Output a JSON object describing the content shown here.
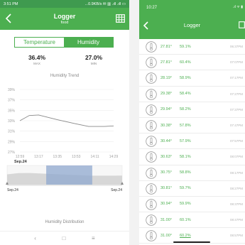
{
  "left_phone": {
    "status_bar": {
      "time": "3:51 PM",
      "icons": "...0.9KB/s ✉ ▥ .ıll .ıll ▭"
    },
    "header": {
      "title": "Logger",
      "subtitle": "food"
    },
    "tabs": [
      {
        "label": "Temperature",
        "active": false
      },
      {
        "label": "Humidity",
        "active": true
      }
    ],
    "stats": {
      "max": {
        "value": "36.4%",
        "label": "MAX"
      },
      "min": {
        "value": "27.0%",
        "label": "MIN"
      }
    },
    "trend_title": "Humidity Trend",
    "distribution_title": "Humidity Distribution",
    "nav": {
      "back": "‹",
      "home": "□",
      "menu": "≡"
    },
    "chart_data": {
      "type": "line",
      "title": "Humidity Trend",
      "y_ticks": [
        "39%",
        "37%",
        "35%",
        "33%",
        "31%",
        "29%",
        "27%"
      ],
      "ylim": [
        27,
        39
      ],
      "x_ticks": [
        "12:59",
        "13:17",
        "13:35",
        "13:53",
        "14:11",
        "14:29"
      ],
      "x_date": "Sep.24",
      "x": [
        "12:59",
        "13:08",
        "13:17",
        "13:35",
        "13:53",
        "14:05",
        "14:20",
        "14:29"
      ],
      "values": [
        33.0,
        34.0,
        34.1,
        33.2,
        32.4,
        31.9,
        31.9,
        32.0
      ],
      "grid": true,
      "line_color": "#888888",
      "navigator": {
        "start_label": "Sep.24",
        "end_label": "Sep.24",
        "selection_start_fraction": 0.34,
        "selection_end_fraction": 0.74
      }
    }
  },
  "right_phone": {
    "status_bar": {
      "time": "10:27",
      "icons": ".ıl ᯤ ▮"
    },
    "header": {
      "title": "Logger"
    },
    "records": [
      {
        "temp": "27.81°",
        "hum": "59.1%",
        "time": "06:37PM"
      },
      {
        "temp": "27.81°",
        "hum": "60.4%",
        "time": "07:07PM"
      },
      {
        "temp": "28.19°",
        "hum": "58.9%",
        "time": "07:17PM"
      },
      {
        "temp": "29.38°",
        "hum": "58.4%",
        "time": "07:27PM"
      },
      {
        "temp": "29.94°",
        "hum": "58.2%",
        "time": "07:37PM"
      },
      {
        "temp": "30.38°",
        "hum": "57.8%",
        "time": "07:47PM"
      },
      {
        "temp": "30.44°",
        "hum": "57.9%",
        "time": "07:57PM"
      },
      {
        "temp": "30.63°",
        "hum": "58.1%",
        "time": "08:07PM"
      },
      {
        "temp": "30.75°",
        "hum": "58.8%",
        "time": "08:17PM"
      },
      {
        "temp": "30.81°",
        "hum": "59.7%",
        "time": "08:27PM"
      },
      {
        "temp": "30.94°",
        "hum": "59.9%",
        "time": "08:37PM"
      },
      {
        "temp": "31.00°",
        "hum": "60.1%",
        "time": "08:47PM"
      },
      {
        "temp": "31.00°",
        "hum": "60.2%",
        "time": "08:57PM"
      }
    ]
  },
  "colors": {
    "accent": "#4caf50",
    "accent_dark": "#3f9a4f",
    "selection": "#8fa8cf"
  }
}
